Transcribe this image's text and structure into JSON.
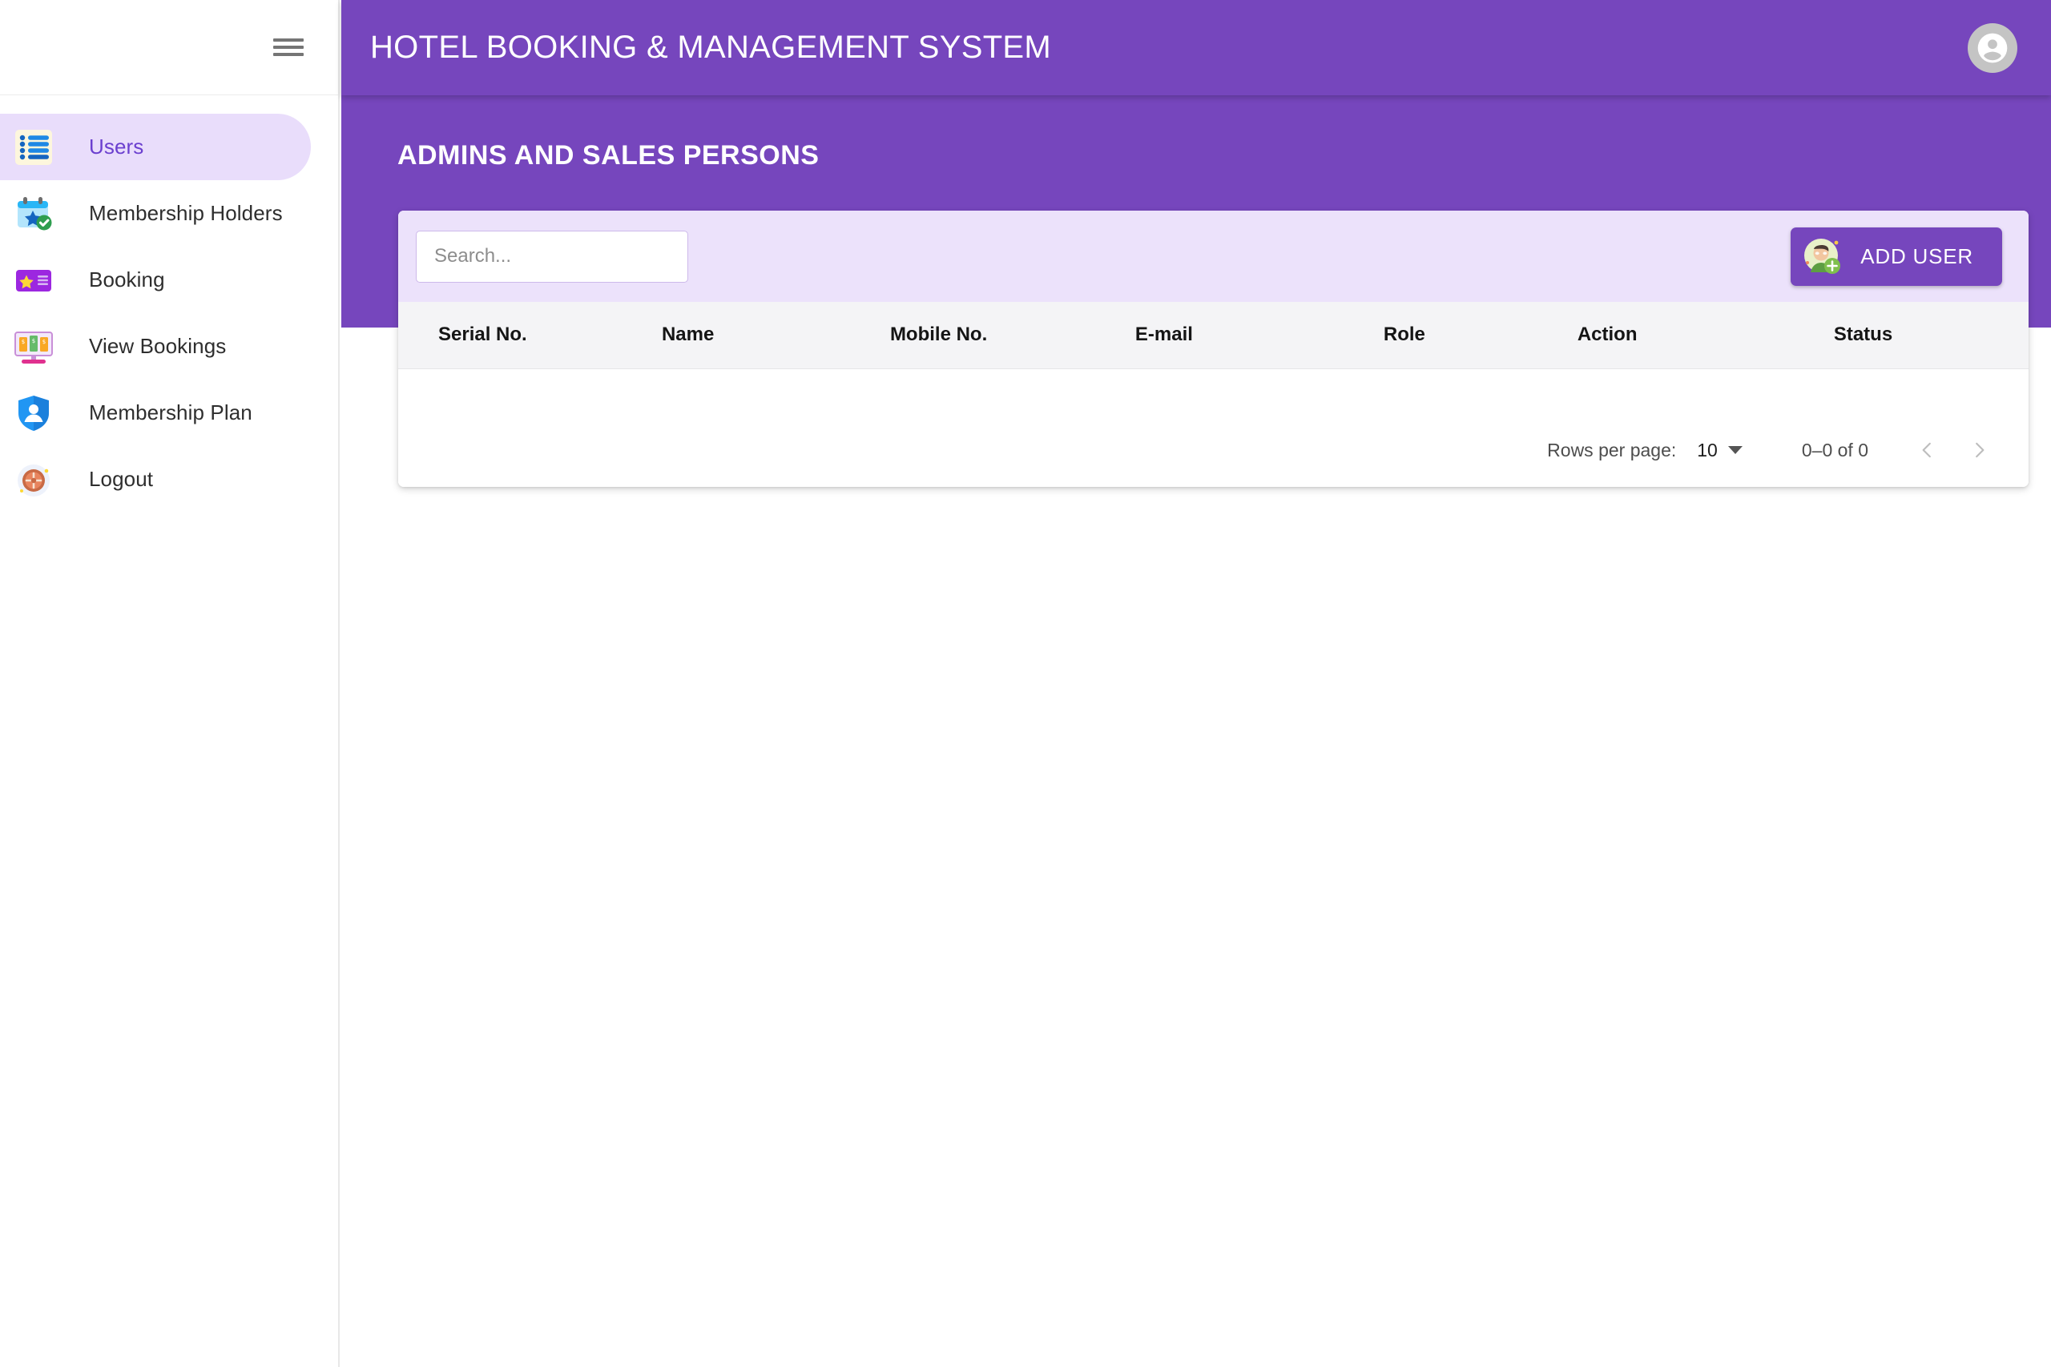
{
  "appbar": {
    "title": "HOTEL BOOKING & MANAGEMENT SYSTEM",
    "menu_icon": "hamburger-menu-icon",
    "account_icon": "account-circle-icon"
  },
  "sidebar": {
    "items": [
      {
        "label": "Users",
        "icon": "list-icon",
        "active": true
      },
      {
        "label": "Membership Holders",
        "icon": "calendar-star-check-icon",
        "active": false
      },
      {
        "label": "Booking",
        "icon": "booking-card-star-icon",
        "active": false
      },
      {
        "label": "View Bookings",
        "icon": "monitor-money-icon",
        "active": false
      },
      {
        "label": "Membership Plan",
        "icon": "shield-person-icon",
        "active": false
      },
      {
        "label": "Logout",
        "icon": "logout-target-icon",
        "active": false
      }
    ]
  },
  "banner": {
    "title": "ADMINS AND SALES PERSONS"
  },
  "toolbar": {
    "search_placeholder": "Search...",
    "search_value": "",
    "add_user_label": "ADD USER",
    "add_user_icon": "add-user-avatar-icon"
  },
  "table": {
    "columns": [
      {
        "label": "Serial No."
      },
      {
        "label": "Name"
      },
      {
        "label": "Mobile No."
      },
      {
        "label": "E-mail"
      },
      {
        "label": "Role"
      },
      {
        "label": "Action"
      },
      {
        "label": "Status"
      }
    ],
    "rows": []
  },
  "pagination": {
    "rows_per_page_label": "Rows per page:",
    "rows_per_page_value": "10",
    "range_label": "0–0 of 0",
    "prev_icon": "chevron-left-icon",
    "next_icon": "chevron-right-icon"
  },
  "colors": {
    "primary_purple": "#7646bd",
    "active_item_bg": "#e9ddfb",
    "active_item_text": "#6b3fcf",
    "toolbar_bg": "#ece2fb",
    "table_header_bg": "#f4f4f6"
  }
}
